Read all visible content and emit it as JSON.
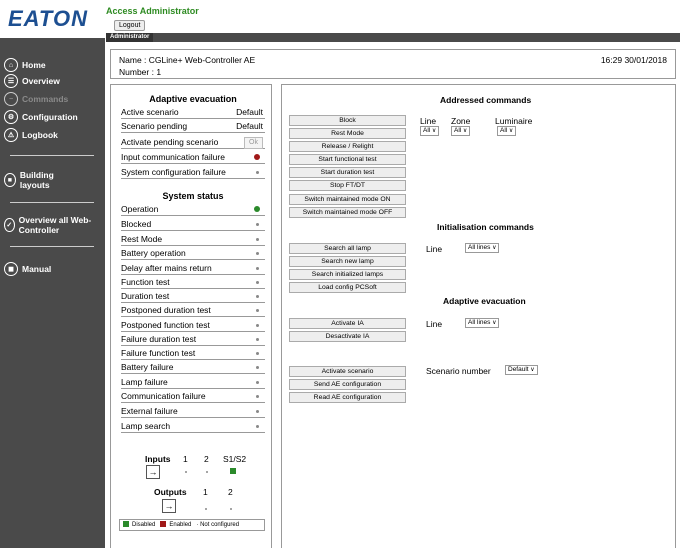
{
  "header": {
    "logo": "EATON",
    "user": "Access Administrator",
    "logout_label": "Logout",
    "tab_label": "Administrator"
  },
  "sidebar": {
    "items": [
      {
        "label": "Home",
        "icon": "home-icon"
      },
      {
        "label": "Overview",
        "icon": "overview-icon"
      },
      {
        "label": "Commands",
        "icon": "commands-icon",
        "disabled": true
      },
      {
        "label": "Configuration",
        "icon": "configuration-icon"
      },
      {
        "label": "Logbook",
        "icon": "logbook-icon"
      },
      {
        "label": "Building layouts",
        "icon": "building-icon"
      },
      {
        "label": "Overview all Web-Controller",
        "icon": "web-controller-icon"
      },
      {
        "label": "Manual",
        "icon": "manual-icon"
      }
    ]
  },
  "info": {
    "name": "Name : CGLine+ Web-Controller AE",
    "number": "Number : 1",
    "datetime": "16:29 30/01/2018"
  },
  "adaptive": {
    "title": "Adaptive evacuation",
    "rows": [
      {
        "label": "Active scenario",
        "value": "Default"
      },
      {
        "label": "Scenario pending",
        "value": "Default"
      },
      {
        "label": "Activate pending scenario",
        "button": "Ok"
      },
      {
        "label": "Input communication failure",
        "state": "red"
      },
      {
        "label": "System configuration failure",
        "state": "grey"
      }
    ]
  },
  "system": {
    "title": "System status",
    "rows": [
      {
        "label": "Operation",
        "state": "green"
      },
      {
        "label": "Blocked",
        "state": "grey"
      },
      {
        "label": "Rest Mode",
        "state": "grey"
      },
      {
        "label": "Battery operation",
        "state": "grey"
      },
      {
        "label": "Delay after mains return",
        "state": "grey"
      },
      {
        "label": "Function test",
        "state": "grey"
      },
      {
        "label": "Duration test",
        "state": "grey"
      },
      {
        "label": "Postponed duration test",
        "state": "grey"
      },
      {
        "label": "Postponed function test",
        "state": "grey"
      },
      {
        "label": "Failure duration test",
        "state": "grey"
      },
      {
        "label": "Failure function test",
        "state": "grey"
      },
      {
        "label": "Battery failure",
        "state": "grey"
      },
      {
        "label": "Lamp failure",
        "state": "grey"
      },
      {
        "label": "Communication failure",
        "state": "grey"
      },
      {
        "label": "External failure",
        "state": "grey"
      },
      {
        "label": "Lamp search",
        "state": "grey"
      }
    ]
  },
  "io": {
    "inputs_label": "Inputs",
    "inputs_cols": [
      "1",
      "2",
      "S1/S2"
    ],
    "outputs_label": "Outputs",
    "outputs_cols": [
      "1",
      "2"
    ]
  },
  "legend": {
    "disabled": "Disabled",
    "enabled": "Enabled",
    "not_configured": "Not configured",
    "colors": {
      "disabled": "#2b8a2b",
      "enabled": "#a01818"
    }
  },
  "addressed": {
    "title": "Addressed commands",
    "buttons": [
      "Block",
      "Rest Mode",
      "Release / Relight",
      "Start functional test",
      "Start duration test",
      "Stop FT/DT",
      "Switch maintained mode ON",
      "Switch maintained mode OFF"
    ],
    "line_label": "Line",
    "zone_label": "Zone",
    "luminaire_label": "Luminaire",
    "line_value": "All",
    "zone_value": "All",
    "luminaire_value": "All"
  },
  "initialisation": {
    "title": "Initialisation commands",
    "buttons": [
      "Search all lamp",
      "Search new lamp",
      "Search initialized lamps",
      "Load config PCSoft"
    ],
    "line_label": "Line",
    "line_value": "All lines"
  },
  "adaptive_cmd": {
    "title": "Adaptive evacuation",
    "buttons": [
      "Activate IA",
      "Desactivate IA"
    ],
    "line_label": "Line",
    "line_value": "All lines"
  },
  "scenario": {
    "buttons": [
      "Activate scenario",
      "Send AE configuration",
      "Read AE configuration"
    ],
    "label": "Scenario number",
    "value": "Default"
  }
}
